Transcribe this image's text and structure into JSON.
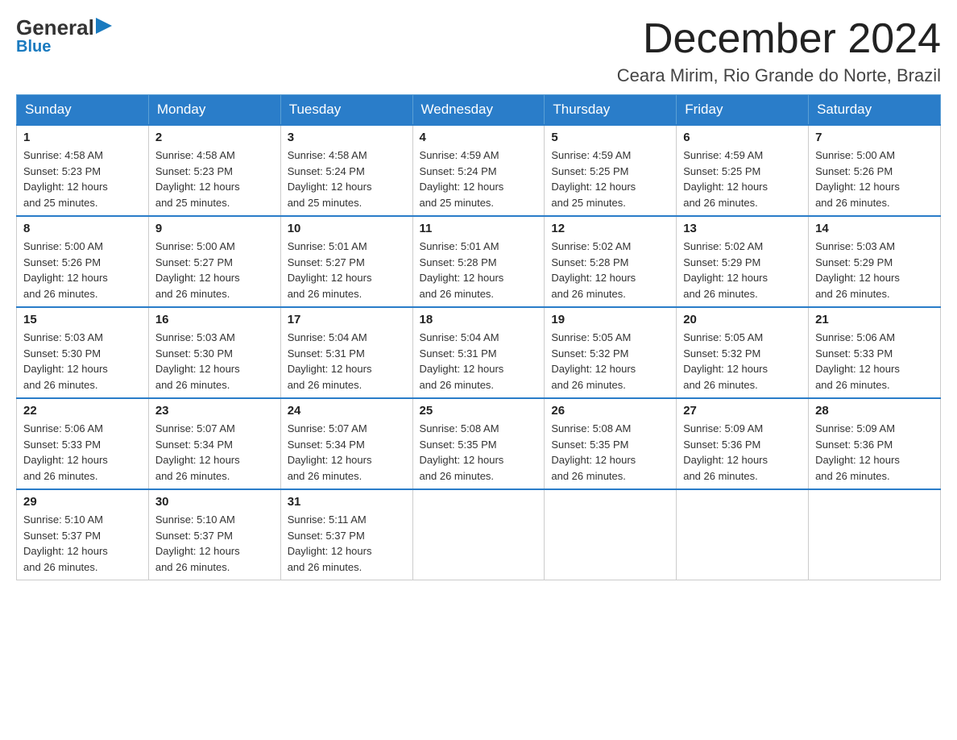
{
  "logo": {
    "line1": "General",
    "triangle": "▶",
    "line2": "Blue"
  },
  "title": "December 2024",
  "location": "Ceara Mirim, Rio Grande do Norte, Brazil",
  "weekdays": [
    "Sunday",
    "Monday",
    "Tuesday",
    "Wednesday",
    "Thursday",
    "Friday",
    "Saturday"
  ],
  "weeks": [
    [
      {
        "day": "1",
        "sunrise": "4:58 AM",
        "sunset": "5:23 PM",
        "daylight": "12 hours and 25 minutes."
      },
      {
        "day": "2",
        "sunrise": "4:58 AM",
        "sunset": "5:23 PM",
        "daylight": "12 hours and 25 minutes."
      },
      {
        "day": "3",
        "sunrise": "4:58 AM",
        "sunset": "5:24 PM",
        "daylight": "12 hours and 25 minutes."
      },
      {
        "day": "4",
        "sunrise": "4:59 AM",
        "sunset": "5:24 PM",
        "daylight": "12 hours and 25 minutes."
      },
      {
        "day": "5",
        "sunrise": "4:59 AM",
        "sunset": "5:25 PM",
        "daylight": "12 hours and 25 minutes."
      },
      {
        "day": "6",
        "sunrise": "4:59 AM",
        "sunset": "5:25 PM",
        "daylight": "12 hours and 26 minutes."
      },
      {
        "day": "7",
        "sunrise": "5:00 AM",
        "sunset": "5:26 PM",
        "daylight": "12 hours and 26 minutes."
      }
    ],
    [
      {
        "day": "8",
        "sunrise": "5:00 AM",
        "sunset": "5:26 PM",
        "daylight": "12 hours and 26 minutes."
      },
      {
        "day": "9",
        "sunrise": "5:00 AM",
        "sunset": "5:27 PM",
        "daylight": "12 hours and 26 minutes."
      },
      {
        "day": "10",
        "sunrise": "5:01 AM",
        "sunset": "5:27 PM",
        "daylight": "12 hours and 26 minutes."
      },
      {
        "day": "11",
        "sunrise": "5:01 AM",
        "sunset": "5:28 PM",
        "daylight": "12 hours and 26 minutes."
      },
      {
        "day": "12",
        "sunrise": "5:02 AM",
        "sunset": "5:28 PM",
        "daylight": "12 hours and 26 minutes."
      },
      {
        "day": "13",
        "sunrise": "5:02 AM",
        "sunset": "5:29 PM",
        "daylight": "12 hours and 26 minutes."
      },
      {
        "day": "14",
        "sunrise": "5:03 AM",
        "sunset": "5:29 PM",
        "daylight": "12 hours and 26 minutes."
      }
    ],
    [
      {
        "day": "15",
        "sunrise": "5:03 AM",
        "sunset": "5:30 PM",
        "daylight": "12 hours and 26 minutes."
      },
      {
        "day": "16",
        "sunrise": "5:03 AM",
        "sunset": "5:30 PM",
        "daylight": "12 hours and 26 minutes."
      },
      {
        "day": "17",
        "sunrise": "5:04 AM",
        "sunset": "5:31 PM",
        "daylight": "12 hours and 26 minutes."
      },
      {
        "day": "18",
        "sunrise": "5:04 AM",
        "sunset": "5:31 PM",
        "daylight": "12 hours and 26 minutes."
      },
      {
        "day": "19",
        "sunrise": "5:05 AM",
        "sunset": "5:32 PM",
        "daylight": "12 hours and 26 minutes."
      },
      {
        "day": "20",
        "sunrise": "5:05 AM",
        "sunset": "5:32 PM",
        "daylight": "12 hours and 26 minutes."
      },
      {
        "day": "21",
        "sunrise": "5:06 AM",
        "sunset": "5:33 PM",
        "daylight": "12 hours and 26 minutes."
      }
    ],
    [
      {
        "day": "22",
        "sunrise": "5:06 AM",
        "sunset": "5:33 PM",
        "daylight": "12 hours and 26 minutes."
      },
      {
        "day": "23",
        "sunrise": "5:07 AM",
        "sunset": "5:34 PM",
        "daylight": "12 hours and 26 minutes."
      },
      {
        "day": "24",
        "sunrise": "5:07 AM",
        "sunset": "5:34 PM",
        "daylight": "12 hours and 26 minutes."
      },
      {
        "day": "25",
        "sunrise": "5:08 AM",
        "sunset": "5:35 PM",
        "daylight": "12 hours and 26 minutes."
      },
      {
        "day": "26",
        "sunrise": "5:08 AM",
        "sunset": "5:35 PM",
        "daylight": "12 hours and 26 minutes."
      },
      {
        "day": "27",
        "sunrise": "5:09 AM",
        "sunset": "5:36 PM",
        "daylight": "12 hours and 26 minutes."
      },
      {
        "day": "28",
        "sunrise": "5:09 AM",
        "sunset": "5:36 PM",
        "daylight": "12 hours and 26 minutes."
      }
    ],
    [
      {
        "day": "29",
        "sunrise": "5:10 AM",
        "sunset": "5:37 PM",
        "daylight": "12 hours and 26 minutes."
      },
      {
        "day": "30",
        "sunrise": "5:10 AM",
        "sunset": "5:37 PM",
        "daylight": "12 hours and 26 minutes."
      },
      {
        "day": "31",
        "sunrise": "5:11 AM",
        "sunset": "5:37 PM",
        "daylight": "12 hours and 26 minutes."
      },
      null,
      null,
      null,
      null
    ]
  ],
  "labels": {
    "sunrise": "Sunrise:",
    "sunset": "Sunset:",
    "daylight": "Daylight:"
  }
}
